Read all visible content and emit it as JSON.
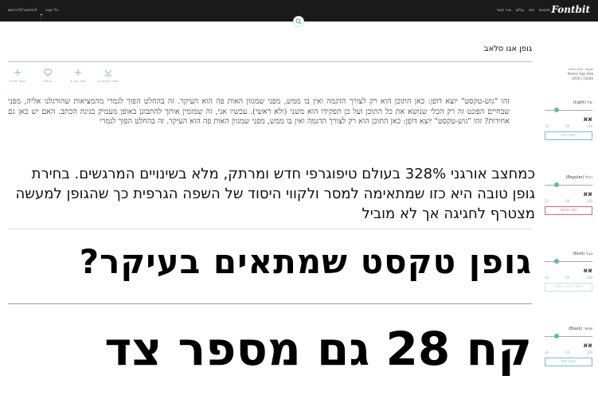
{
  "topbar": {
    "logo": "Fontbit",
    "nav": [
      "פונטים",
      "חם",
      "עלים",
      "צור קשר"
    ],
    "left_links": [
      "להתחבר/להירשם",
      "|",
      "כל קצה"
    ]
  },
  "font": {
    "title": "גופן אגו סלאב",
    "actions": [
      {
        "label": "שמור לקטגוריה",
        "icon": "download-icon"
      },
      {
        "label": "שתף בקרוב",
        "icon": "share-icon"
      },
      {
        "label": "אהבתי",
        "icon": "heart-icon"
      },
      {
        "label": "הוסף לפריט",
        "icon": "plus-icon"
      }
    ],
    "meta": [
      "מעצב: אלון גרודנר",
      "Name: Ego Slab",
      "2016 | 142Kb"
    ]
  },
  "preview": {
    "paragraph": "זהו \"גוש-טקסט\" יוצא דופן: כאן התוכן הוא רק לצורך הדגמה ואין בו ממש, מפני שמגוון האות פה הוא העיקר. זה בהחלט הפוך לגמרי מהמציאות שהורגלנו אליה, מפני שבחיים הפונט זה רק הכלי שנושא את כל התוכן ועל כן תפקידו הוא משני (ולא ראשי). עכשיו אני, זה שמזמין אותך להתבונן באופן מעמיק בגיגה הכתב. האם יש כאן גם אחידות? זהו \"גוש-טקסט\" יוצא דופן: כאן התוכן הוא רק לצורך הדגמה ואין בו ממש, מפני שמגוון האות פה הוא העיקר. זה בהחלט הפוך לגמרי",
    "medium": "כמחצב אורגני 328% בעולם טיפוגרפי חדש ומרתק, מלא בשינויים המרגשים. בחירת גופן טובה היא כזו שמתאימה למסר ולקווי היסוד של השפה הגרפית כך שהגופן למעשה מצטרף לחגיגה אך לא מוביל",
    "big": "גופן טקסט שמתאים בעיקר?",
    "huge": "קח 28 גם מספר צד"
  },
  "weights": [
    {
      "name": "קל (Light)",
      "sample": "אא",
      "button": "הוסף לסל",
      "style": "normal"
    },
    {
      "name": "רגיל (Regular)",
      "sample": "אא",
      "button": "הסר מהסל",
      "style": "red"
    },
    {
      "name": "כבד (Bold)",
      "sample": "אא",
      "button": "הוסף לפריט חשבון",
      "style": "gray"
    },
    {
      "name": "שחור (Black)",
      "sample": "אא",
      "button": "הוסף לסל",
      "style": "normal"
    }
  ],
  "slider_ticks": [
    "32",
    "60",
    "128"
  ]
}
